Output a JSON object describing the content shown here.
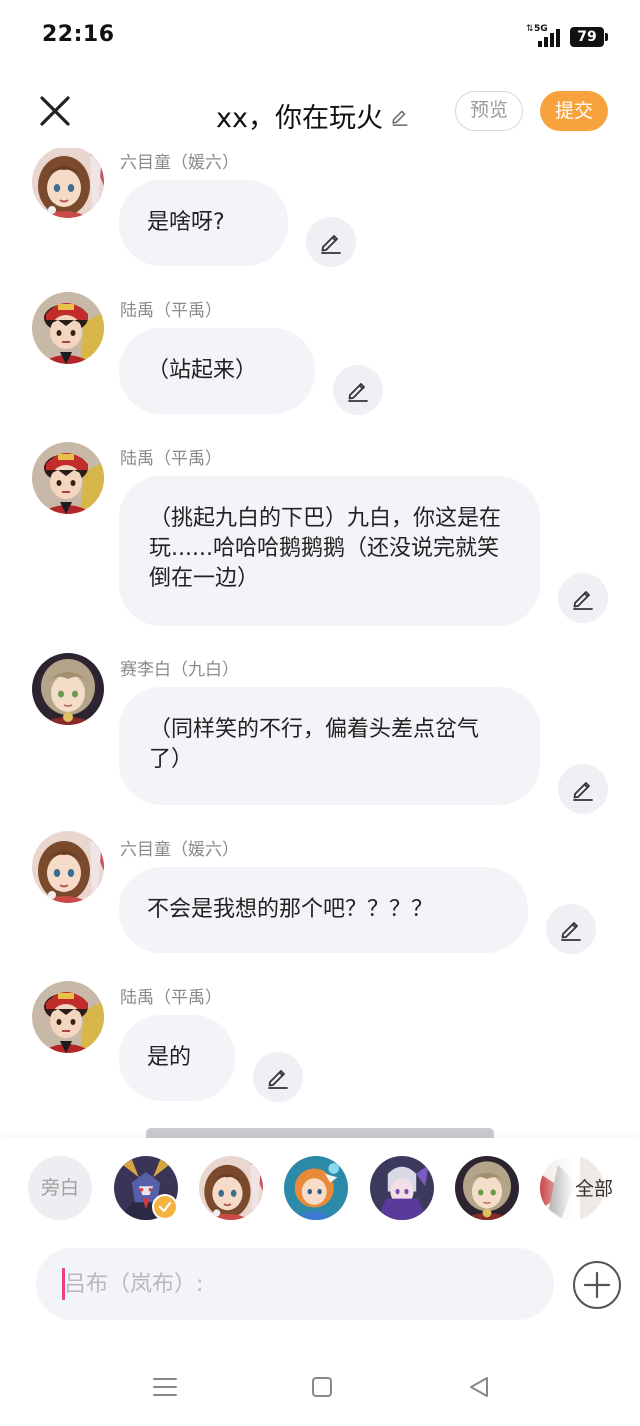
{
  "status_bar": {
    "time": "22:16",
    "network": "5G",
    "battery": "79"
  },
  "header": {
    "title": "xx，你在玩火",
    "preview_label": "预览",
    "submit_label": "提交"
  },
  "messages": [
    {
      "sender": "六目童（媛六）",
      "text": "是啥呀?",
      "avatar": "girl-brown-hair"
    },
    {
      "sender": "陆禹（平禹）",
      "text": "（站起来）",
      "avatar": "boy-red-cap"
    },
    {
      "sender": "陆禹（平禹）",
      "text": "（挑起九白的下巴）九白，你这是在玩......哈哈哈鹅鹅鹅（还没说完就笑倒在一边）",
      "avatar": "boy-red-cap"
    },
    {
      "sender": "赛李白（九白）",
      "text": "（同样笑的不行，偏着头差点岔气了）",
      "avatar": "boy-light-hair"
    },
    {
      "sender": "六目童（媛六）",
      "text": "不会是我想的那个吧？？？？",
      "avatar": "girl-brown-hair"
    },
    {
      "sender": "陆禹（平禹）",
      "text": "是的",
      "avatar": "boy-red-cap"
    }
  ],
  "characters": {
    "narrator_label": "旁白",
    "all_label": "全部",
    "avatars": [
      "robot-mecha",
      "girl-brown-hair",
      "girl-orange-hair-blue",
      "purple-armor",
      "boy-light-hair",
      "partial-character"
    ],
    "selected_index": 0
  },
  "composer": {
    "placeholder": "吕布（岚布）:",
    "value": ""
  },
  "colors": {
    "accent": "#f7a23c",
    "bubble": "#f3f4f8",
    "caret": "#e8417f",
    "selected_check": "#f5b341"
  },
  "icons": [
    "close-icon",
    "pencil-icon",
    "check-icon",
    "plus-icon",
    "menu-icon",
    "home-square-icon",
    "back-triangle-icon"
  ]
}
